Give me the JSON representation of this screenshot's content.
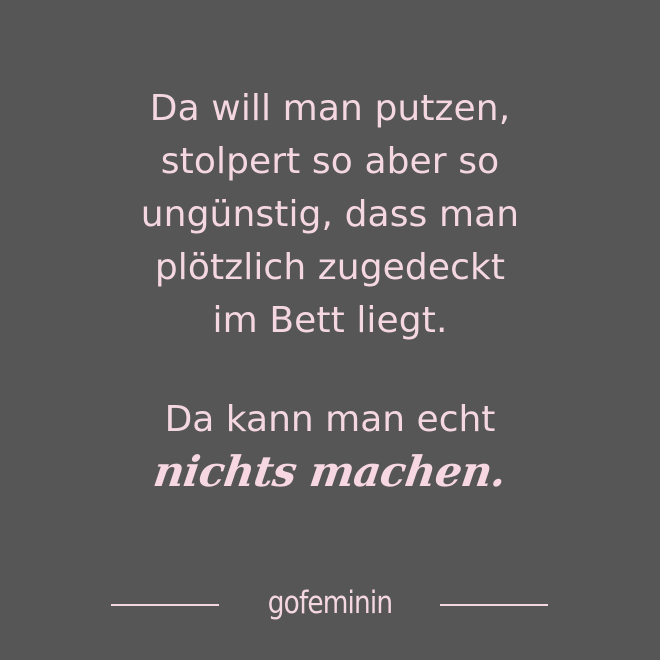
{
  "quote": {
    "lines": [
      "Da will man putzen,",
      "stolpert so aber so",
      "ungünstig, dass man",
      "plötzlich zugedeckt",
      "im Bett liegt."
    ],
    "closing_line": "Da kann man echt",
    "emphasis": "nichts machen."
  },
  "footer": {
    "logo_text": "gofeminin"
  },
  "colors": {
    "background": "#565656",
    "text": "#f4d7e1"
  }
}
